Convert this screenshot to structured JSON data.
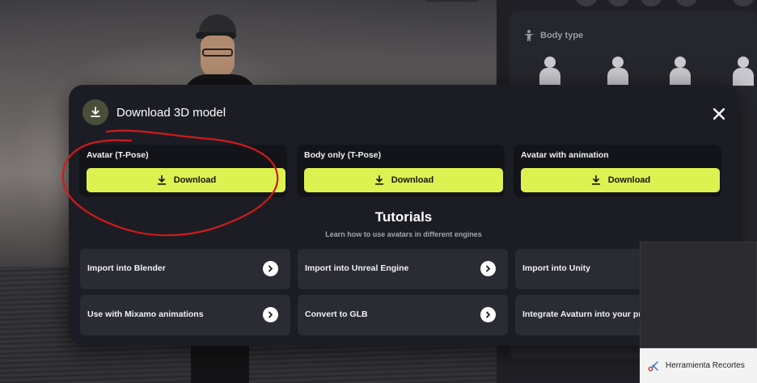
{
  "modal": {
    "title": "Download 3D model",
    "options": [
      {
        "title": "Avatar (T-Pose)",
        "button_label": "Download"
      },
      {
        "title": "Body only (T-Pose)",
        "button_label": "Download"
      },
      {
        "title": "Avatar with animation",
        "button_label": "Download"
      }
    ],
    "tutorials": {
      "title": "Tutorials",
      "subtitle": "Learn how to use avatars in different engines",
      "items": [
        {
          "label": "Import into Blender"
        },
        {
          "label": "Import into Unreal Engine"
        },
        {
          "label": "Import into Unity"
        },
        {
          "label": "Use with Mixamo animations"
        },
        {
          "label": "Convert to GLB"
        },
        {
          "label": "Integrate Avaturn into your pro"
        }
      ]
    }
  },
  "side_panel": {
    "section_label": "Body type"
  },
  "taskbar": {
    "snip_label": "Herramienta Recortes"
  },
  "colors": {
    "accent": "#dcf251",
    "modal_bg": "#1c1d24",
    "card_bg": "#2a2b33",
    "annotation": "#d11a1a"
  }
}
